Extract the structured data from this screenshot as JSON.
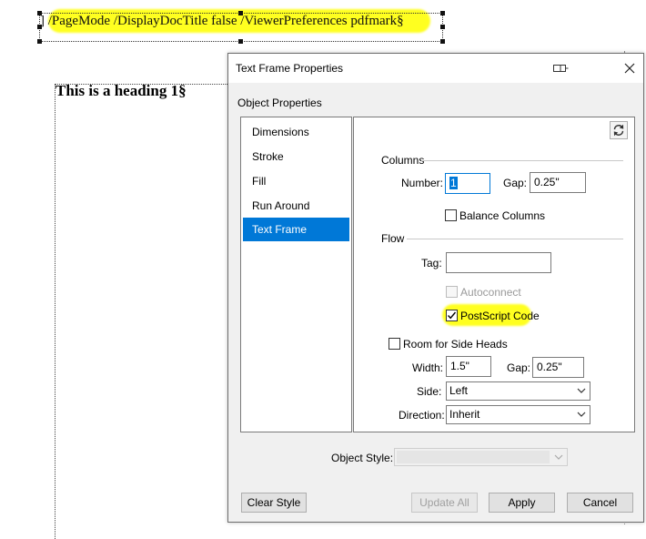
{
  "document": {
    "pdfmark_text": "] /PageMode /DisplayDocTitle false /ViewerPreferences pdfmark§",
    "heading": "This is a heading 1§"
  },
  "dialog": {
    "title": "Text Frame Properties",
    "section_title": "Object Properties",
    "nav": [
      "Dimensions",
      "Stroke",
      "Fill",
      "Run Around",
      "Text Frame"
    ],
    "selected_nav": "Text Frame",
    "columns": {
      "group_label": "Columns",
      "number_label": "Number:",
      "number_value": "1",
      "gap_label": "Gap:",
      "gap_value": "0.25\"",
      "balance_label": "Balance Columns",
      "balance_checked": false
    },
    "flow": {
      "group_label": "Flow",
      "tag_label": "Tag:",
      "tag_value": "",
      "autoconnect_label": "Autoconnect",
      "autoconnect_checked": false,
      "postscript_label": "PostScript Code",
      "postscript_checked": true
    },
    "side_heads": {
      "checkbox_label": "Room for Side Heads",
      "checked": false,
      "width_label": "Width:",
      "width_value": "1.5\"",
      "gap_label": "Gap:",
      "gap_value": "0.25\"",
      "side_label": "Side:",
      "side_value": "Left",
      "direction_label": "Direction:",
      "direction_value": "Inherit"
    },
    "object_style_label": "Object Style:",
    "object_style_value": "",
    "buttons": {
      "clear_style": "Clear Style",
      "update_all": "Update All",
      "apply": "Apply",
      "cancel": "Cancel"
    }
  },
  "colors": {
    "highlight": "#ffff20",
    "selection": "#0078d7",
    "dialog_bg": "#f0f0f0"
  }
}
